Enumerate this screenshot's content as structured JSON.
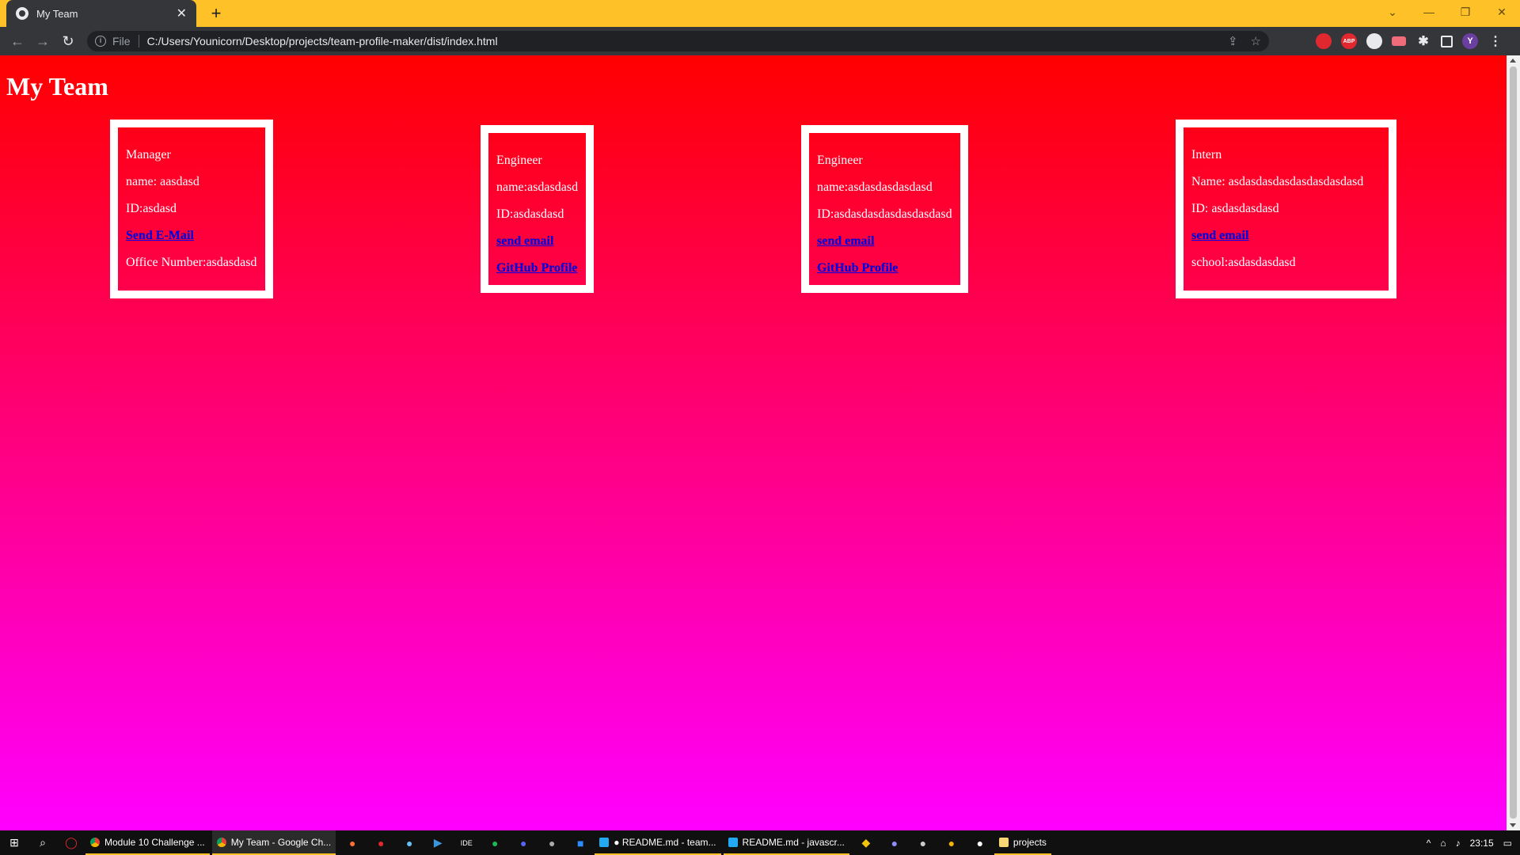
{
  "browser": {
    "tab": {
      "title": "My Team",
      "close": "✕"
    },
    "new_tab": "+",
    "window_controls": {
      "tabsearch": "⌄",
      "minimize": "—",
      "restore": "❐",
      "close": "✕"
    },
    "nav": {
      "back": "←",
      "forward": "→",
      "reload": "↻"
    },
    "omnibox": {
      "info_icon": "i",
      "scheme": "File",
      "url": "C:/Users/Younicorn/Desktop/projects/team-profile-maker/dist/index.html",
      "share_icon": "⇪",
      "star_icon": "☆"
    },
    "extensions": {
      "abp": "ABP",
      "avatar": "Y",
      "puzzle": "✱",
      "menu": "⋮"
    },
    "theme_color": "#FFC128"
  },
  "page": {
    "title": "My Team",
    "gradient_top": "#FF0000",
    "gradient_bottom": "#FF00FF",
    "cards": {
      "manager": {
        "role": "Manager",
        "name": "name: aasdasd",
        "id": "ID:asdasd",
        "email_link": "Send E-Mail",
        "office": "Office Number:asdasdasd"
      },
      "engineer1": {
        "role": "Engineer",
        "name": "name:asdasdasd",
        "id": "ID:asdasdasd",
        "email_link": "send email",
        "github_link": "GitHub Profile"
      },
      "engineer2": {
        "role": "Engineer",
        "name": "name:asdasdasdasdasd",
        "id": "ID:asdasdasdasdasdasdasd",
        "email_link": "send email",
        "github_link": "GitHub Profile"
      },
      "intern": {
        "role": "Intern",
        "name": "Name: asdasdasdasdasdasdasdasd",
        "id": "ID: asdasdasdasd",
        "email_link": "send email",
        "school": "school:asdasdasdasd"
      }
    }
  },
  "taskbar": {
    "start_icon": "⊞",
    "search_icon": "⌕",
    "apps": [
      {
        "label": "Module 10 Challenge ...",
        "icon": "chrome"
      },
      {
        "label": "My Team - Google Ch...",
        "icon": "chrome",
        "active": true
      },
      {
        "label": "● README.md - team...",
        "icon": "vscode"
      },
      {
        "label": "README.md - javascr...",
        "icon": "vscode"
      },
      {
        "label": "projects",
        "icon": "folder"
      }
    ],
    "tray": {
      "chevron": "^",
      "network": "⌂",
      "volume": "♪",
      "time": "23:15",
      "notifications": "▭"
    }
  }
}
